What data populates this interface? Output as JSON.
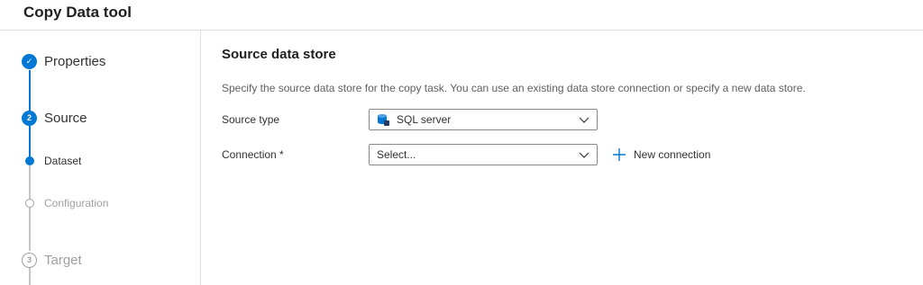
{
  "header": {
    "title": "Copy Data tool"
  },
  "wizard": {
    "steps": [
      {
        "label": "Properties",
        "state": "done",
        "marker": "✓"
      },
      {
        "label": "Source",
        "state": "active",
        "marker": "2"
      },
      {
        "label": "Target",
        "state": "future",
        "marker": "3"
      }
    ],
    "substeps": [
      {
        "label": "Dataset",
        "state": "active"
      },
      {
        "label": "Configuration",
        "state": "future"
      }
    ]
  },
  "main": {
    "title": "Source data store",
    "description": "Specify the source data store for the copy task. You can use an existing data store connection or specify a new data store.",
    "source_type": {
      "label": "Source type",
      "value": "SQL server",
      "icon": "sql-server-icon"
    },
    "connection": {
      "label": "Connection *",
      "value": "Select..."
    },
    "new_connection": {
      "label": "New connection",
      "icon": "plus-icon"
    }
  },
  "colors": {
    "accent": "#0078d4",
    "border": "#e1dfdd",
    "muted": "#a19f9d"
  }
}
